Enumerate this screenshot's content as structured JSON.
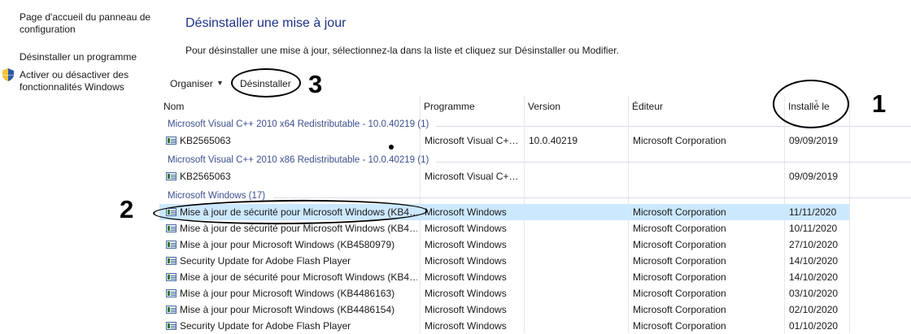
{
  "left_pane": {
    "links": [
      {
        "label": "Page d'accueil du panneau de configuration"
      },
      {
        "label": "Désinstaller un programme"
      },
      {
        "label": "Activer ou désactiver des fonctionnalités Windows"
      }
    ]
  },
  "header": {
    "title": "Désinstaller une mise à jour",
    "subtitle": "Pour désinstaller une mise à jour, sélectionnez-la dans la liste et cliquez sur Désinstaller ou Modifier."
  },
  "toolbar": {
    "organize_label": "Organiser",
    "caret": "▼",
    "uninstall_label": "Désinstaller"
  },
  "columns": {
    "name": "Nom",
    "program": "Programme",
    "version": "Version",
    "publisher": "Éditeur",
    "installed": "Installé le",
    "sort_arrow": "⌄"
  },
  "groups": [
    {
      "label": "Microsoft Visual C++ 2010  x64 Redistributable - 10.0.40219 (1)"
    },
    {
      "label": "Microsoft Visual C++ 2010  x86 Redistributable - 10.0.40219 (1)"
    },
    {
      "label": "Microsoft Windows (17)"
    }
  ],
  "rows": [
    {
      "name": "KB2565063",
      "program": "Microsoft Visual C+…",
      "version": "10.0.40219",
      "publisher": "Microsoft Corporation",
      "installed": "09/09/2019"
    },
    {
      "name": "KB2565063",
      "program": "Microsoft Visual C+…",
      "version": "",
      "publisher": "",
      "installed": "09/09/2019"
    },
    {
      "name": "Mise à jour de sécurité pour Microsoft Windows (KB4…",
      "program": "Microsoft Windows",
      "version": "",
      "publisher": "Microsoft Corporation",
      "installed": "11/11/2020",
      "selected": true
    },
    {
      "name": "Mise à jour de sécurité pour Microsoft Windows (KB4…",
      "program": "Microsoft Windows",
      "version": "",
      "publisher": "Microsoft Corporation",
      "installed": "10/11/2020"
    },
    {
      "name": "Mise à jour pour Microsoft Windows (KB4580979)",
      "program": "Microsoft Windows",
      "version": "",
      "publisher": "Microsoft Corporation",
      "installed": "27/10/2020"
    },
    {
      "name": "Security Update for Adobe Flash Player",
      "program": "Microsoft Windows",
      "version": "",
      "publisher": "Microsoft Corporation",
      "installed": "14/10/2020"
    },
    {
      "name": "Mise à jour de sécurité pour Microsoft Windows (KB4…",
      "program": "Microsoft Windows",
      "version": "",
      "publisher": "Microsoft Corporation",
      "installed": "14/10/2020"
    },
    {
      "name": "Mise à jour pour Microsoft Windows (KB4486163)",
      "program": "Microsoft Windows",
      "version": "",
      "publisher": "Microsoft Corporation",
      "installed": "03/10/2020"
    },
    {
      "name": "Mise à jour pour Microsoft Windows (KB4486154)",
      "program": "Microsoft Windows",
      "version": "",
      "publisher": "Microsoft Corporation",
      "installed": "02/10/2020"
    },
    {
      "name": "Security Update for Adobe Flash Player",
      "program": "Microsoft Windows",
      "version": "",
      "publisher": "Microsoft Corporation",
      "installed": "01/10/2020"
    }
  ],
  "annotations": {
    "one": "1",
    "two": "2",
    "three": "3"
  },
  "colors": {
    "title": "#1e3287",
    "group_header": "#3d4f8f",
    "selected_row": "#cce8ff"
  }
}
